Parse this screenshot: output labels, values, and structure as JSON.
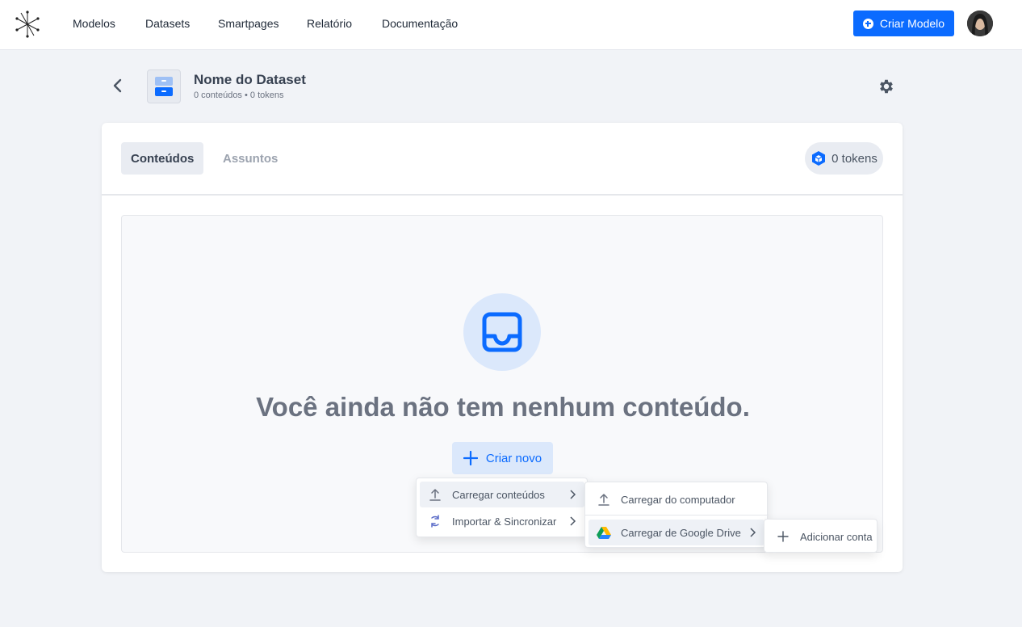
{
  "nav": {
    "items": [
      "Modelos",
      "Datasets",
      "Smartpages",
      "Relatório",
      "Documentação"
    ],
    "create_button": "Criar Modelo"
  },
  "dataset": {
    "title": "Nome do Dataset",
    "subtitle": "0 conteúdos • 0 tokens"
  },
  "tabs": {
    "active": "Conteúdos",
    "inactive": "Assuntos"
  },
  "tokens": "0 tokens",
  "empty_state": {
    "title": "Você ainda não tem nenhum conteúdo.",
    "button": "Criar novo"
  },
  "menu1": {
    "items": [
      "Carregar conteúdos",
      "Importar & Sincronizar"
    ]
  },
  "menu2": {
    "items": [
      "Carregar do computador",
      "Carregar de Google Drive"
    ]
  },
  "menu3": {
    "items": [
      "Adicionar conta"
    ]
  },
  "colors": {
    "accent": "#0b6bff",
    "background": "#f1f3f7"
  },
  "icons": [
    "logo-icon",
    "plus-circle-icon",
    "avatar",
    "back-chevron-icon",
    "dataset-icon",
    "gear-icon",
    "cube-icon",
    "inbox-icon",
    "plus-icon",
    "upload-icon",
    "sync-icon",
    "google-drive-icon",
    "chevron-right-icon"
  ]
}
